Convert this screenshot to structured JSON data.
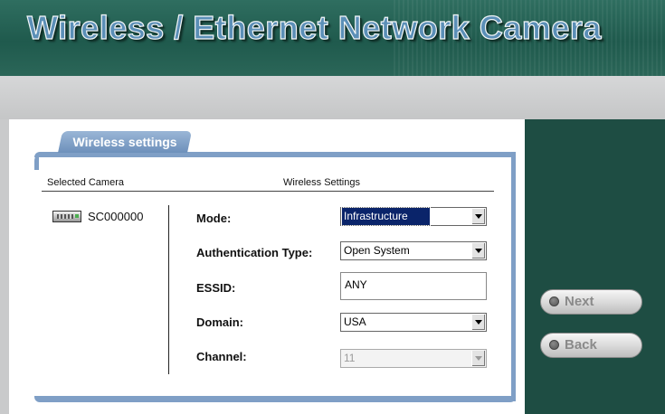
{
  "header": {
    "title": "Wireless / Ethernet Network Camera"
  },
  "tab": {
    "label": "Wireless settings"
  },
  "columns": {
    "selected_camera": "Selected Camera",
    "wireless_settings": "Wireless Settings"
  },
  "camera": {
    "id": "SC000000",
    "icon": "camera-device-icon"
  },
  "form": {
    "mode": {
      "label": "Mode:",
      "value": "Infrastructure"
    },
    "auth": {
      "label": "Authentication Type:",
      "value": "Open System"
    },
    "essid": {
      "label": "ESSID:",
      "value": "ANY"
    },
    "domain": {
      "label": "Domain:",
      "value": "USA"
    },
    "channel": {
      "label": "Channel:",
      "value": "11"
    }
  },
  "nav": {
    "next": "Next",
    "back": "Back"
  },
  "colors": {
    "header_bg": "#1f5a4d",
    "side_panel": "#1e4d43",
    "tab_blue": "#7f9fc6",
    "title_blue": "#5b8fb7"
  }
}
